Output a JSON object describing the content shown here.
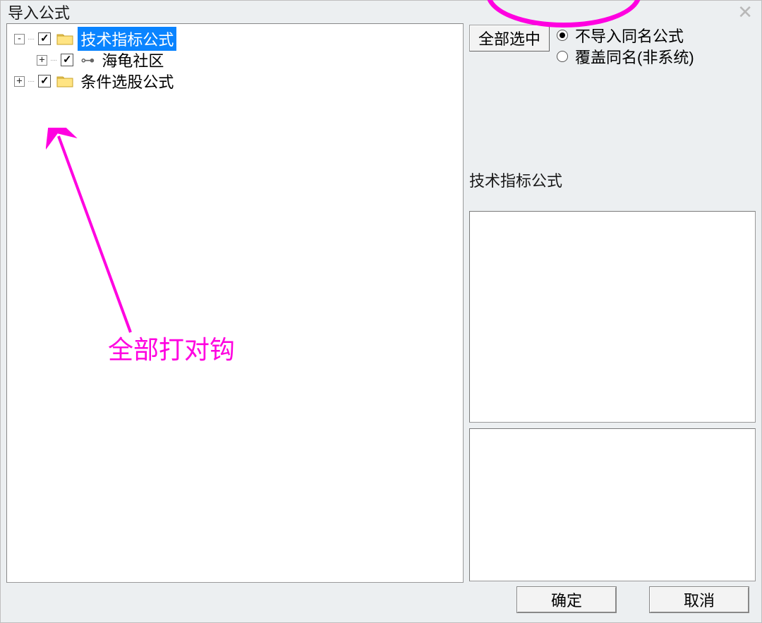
{
  "window": {
    "title": "导入公式"
  },
  "tree": {
    "nodes": [
      {
        "level": 1,
        "expander": "-",
        "checked": true,
        "icon": "folder",
        "label": "技术指标公式",
        "selected": true
      },
      {
        "level": 2,
        "expander": "+",
        "checked": true,
        "icon": "key",
        "label": "海龟社区",
        "selected": false
      },
      {
        "level": 1,
        "expander": "+",
        "checked": true,
        "icon": "folder",
        "label": "条件选股公式",
        "selected": false
      }
    ]
  },
  "right": {
    "select_all": "全部选中",
    "radio1": "不导入同名公式",
    "radio2": "覆盖同名(非系统)",
    "radio_selected": 0,
    "info_label": "技术指标公式"
  },
  "buttons": {
    "ok": "确定",
    "cancel": "取消"
  },
  "annotation": {
    "text": "全部打对钩"
  }
}
